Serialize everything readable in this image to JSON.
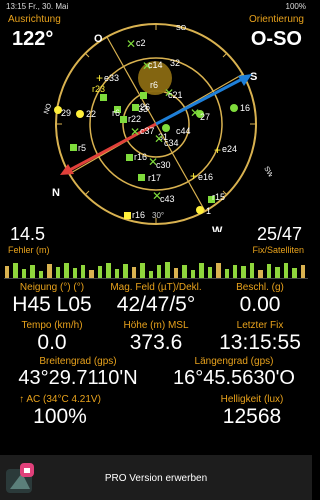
{
  "status": {
    "left": "13:15  Fr., 30. Mai",
    "right": "100%"
  },
  "top": {
    "left_label": "Ausrichtung",
    "left_value": "122°",
    "right_label": "Orientierung",
    "right_value": "O-SO"
  },
  "compass": {
    "dir_labels": [
      "N",
      "SO",
      "S",
      "SW",
      "W",
      "NW",
      "NO",
      "O"
    ],
    "elevation_label": "30°",
    "satellites": [
      "c2",
      "c14",
      "32",
      "r23",
      "e33",
      "r5",
      "22",
      "29",
      "r16",
      "33",
      "26",
      "31",
      "c21",
      "r22",
      "c34",
      "c37",
      "16",
      "27",
      "c44",
      "r6",
      "r6",
      "c30",
      "e24",
      "r17",
      "e16",
      "r15",
      "c43",
      "1",
      "r16"
    ]
  },
  "mid": {
    "left_value": "14.5",
    "left_label": "Fehler (m)",
    "right_value": "25/47",
    "right_label": "Fix/Satelliten"
  },
  "signal_bars": [
    0.55,
    0.7,
    0.4,
    0.6,
    0.3,
    0.65,
    0.5,
    0.7,
    0.45,
    0.6,
    0.35,
    0.55,
    0.7,
    0.4,
    0.62,
    0.5,
    0.68,
    0.3,
    0.58,
    0.72,
    0.44,
    0.6,
    0.38,
    0.66,
    0.5,
    0.7,
    0.42,
    0.6,
    0.55,
    0.68,
    0.35,
    0.62,
    0.5,
    0.7,
    0.45,
    0.58
  ],
  "grid": [
    {
      "label": "Neigung (°) (°)",
      "value": "H45 L05"
    },
    {
      "label": "Mag. Feld (µT)/Dekl.",
      "value": "42/47/5°"
    },
    {
      "label": "Beschl. (g)",
      "value": "0.00"
    },
    {
      "label": "Tempo (km/h)",
      "value": "0.0"
    },
    {
      "label": "Höhe (m) MSL",
      "value": "373.6"
    },
    {
      "label": "Letzter Fix",
      "value": "13:15:55"
    }
  ],
  "coords": {
    "lat_label": "Breitengrad (gps)",
    "lat_value": "43°29.7110'N",
    "lon_label": "Längengrad (gps)",
    "lon_value": "16°45.5630'O"
  },
  "battery": {
    "label": "↑ AC (34°C 4.21V)",
    "value": "100%"
  },
  "light": {
    "label": "Helligkeit (lux)",
    "value": "12568"
  },
  "promo": {
    "text": "PRO Version erwerben"
  }
}
